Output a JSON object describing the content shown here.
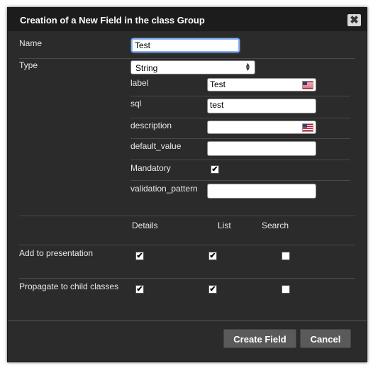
{
  "dialog": {
    "title": "Creation of a New Field in the class Group",
    "close_icon": "close-icon"
  },
  "form": {
    "name_label": "Name",
    "name_value": "Test",
    "type_label": "Type",
    "type_value": "String",
    "props": {
      "label_label": "label",
      "label_value": "Test",
      "sql_label": "sql",
      "sql_value": "test",
      "description_label": "description",
      "description_value": "",
      "default_label": "default_value",
      "default_value": "",
      "mandatory_label": "Mandatory",
      "mandatory_checked": true,
      "validation_label": "validation_pattern",
      "validation_value": ""
    }
  },
  "options": {
    "headers": [
      "Details",
      "List",
      "Search"
    ],
    "rows": [
      {
        "label": "Add to presentation",
        "details": true,
        "list": true,
        "search": false
      },
      {
        "label": "Propagate to child classes",
        "details": true,
        "list": true,
        "search": false
      }
    ]
  },
  "buttons": {
    "create": "Create Field",
    "cancel": "Cancel"
  }
}
